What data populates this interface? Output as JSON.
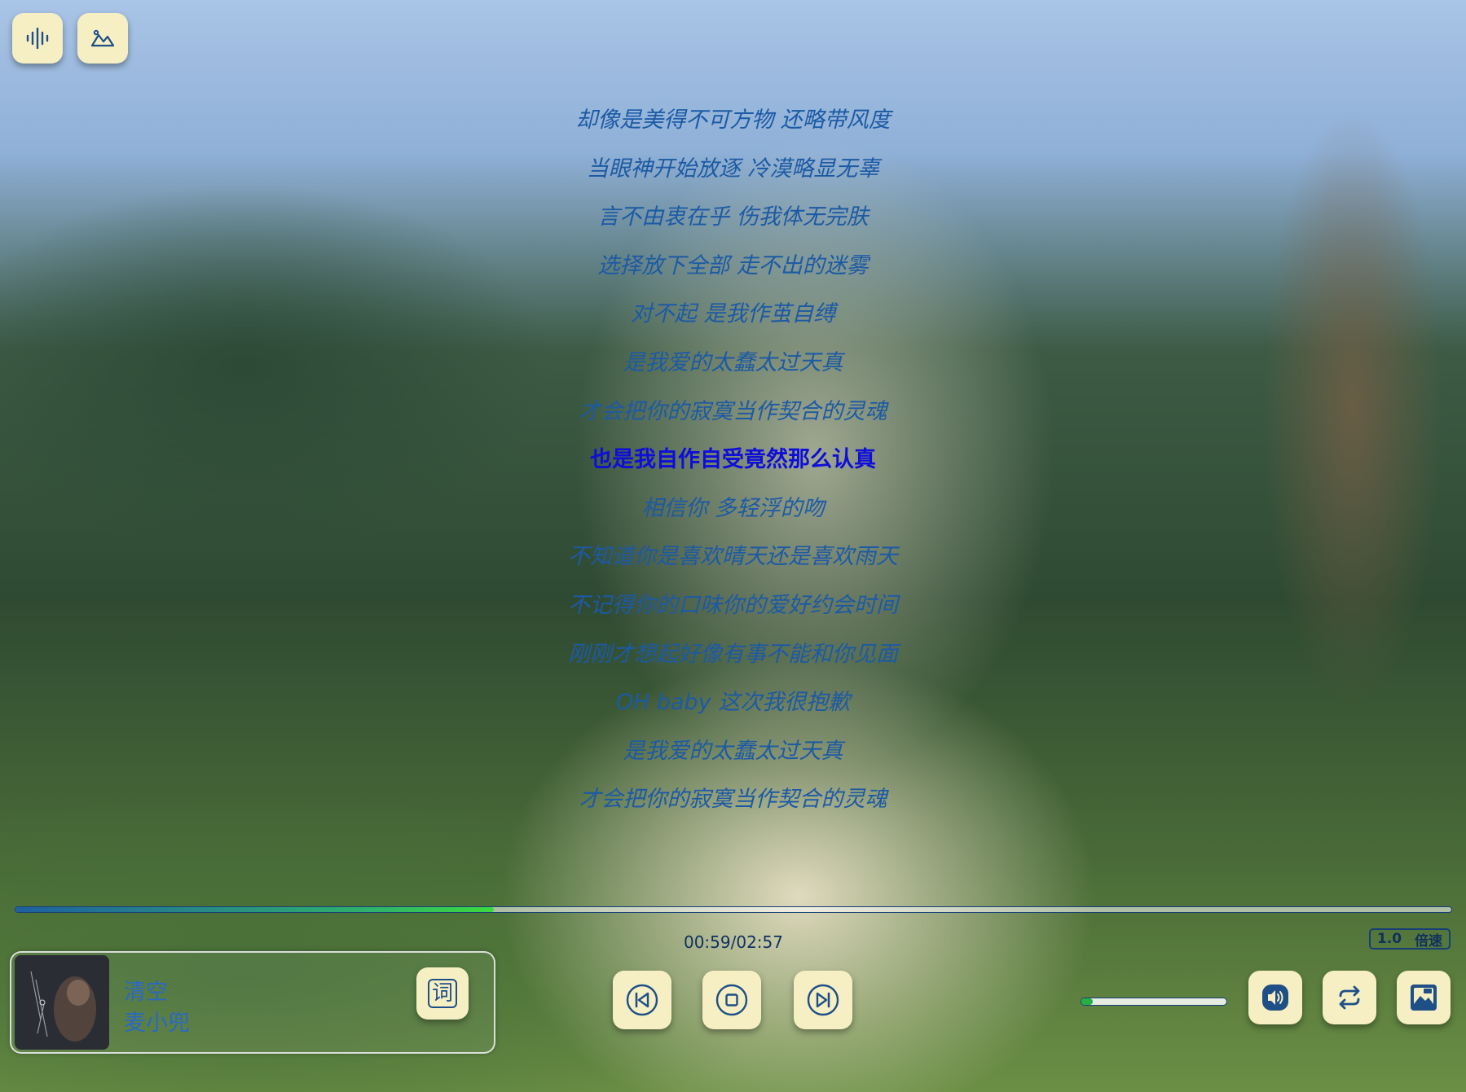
{
  "colors": {
    "accent": "#1c5aa4",
    "current_lyric": "#0e0ed8",
    "button_bg": "#f6efc4",
    "progress_start": "#1e5fa0",
    "progress_end": "#3cdb3c"
  },
  "top_left": {
    "visualizer_icon": "waveform-icon",
    "background_icon": "landscape-icon"
  },
  "lyrics": {
    "current_index": 7,
    "lines": [
      "却像是美得不可方物 还略带风度",
      "当眼神开始放逐 冷漠略显无辜",
      "言不由衷在乎 伤我体无完肤",
      "选择放下全部 走不出的迷雾",
      "对不起 是我作茧自缚",
      "是我爱的太蠢太过天真",
      "才会把你的寂寞当作契合的灵魂",
      "也是我自作自受竟然那么认真",
      "相信你 多轻浮的吻",
      "不知道你是喜欢晴天还是喜欢雨天",
      "不记得你的口味你的爱好约会时间",
      "刚刚才想起好像有事不能和你见面",
      "OH baby 这次我很抱歉",
      "是我爱的太蠢太过天真",
      "才会把你的寂寞当作契合的灵魂"
    ]
  },
  "playback": {
    "progress_fraction": 0.333,
    "time": "00:59/02:57",
    "speed_value": "1.0",
    "speed_label": "倍速"
  },
  "song": {
    "title": "清空",
    "artist": "麦小兜",
    "lyrics_button": "词"
  },
  "controls": {
    "prev_icon": "previous-track-icon",
    "stop_icon": "stop-icon",
    "next_icon": "next-track-icon"
  },
  "volume": {
    "level_fraction": 0.08,
    "icon": "speaker-icon"
  },
  "right_controls": {
    "loop_icon": "repeat-icon",
    "playlist_icon": "playlist-icon"
  }
}
